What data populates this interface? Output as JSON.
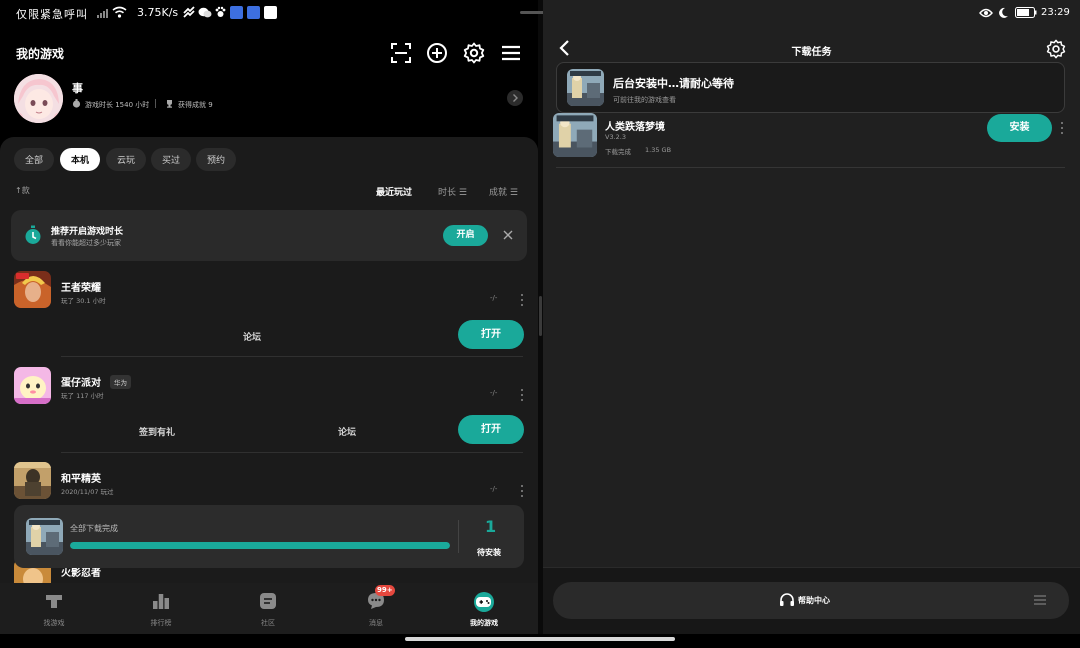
{
  "status_bar": {
    "carrier": "仅限紧急呼叫",
    "net_speed": "3.75K/s",
    "time": "23:29"
  },
  "left": {
    "header_title": "我的游戏",
    "profile": {
      "name": "事",
      "play_time": "游戏时长 1540 小时",
      "achievements": "获得成就 9"
    },
    "filters": [
      "全部",
      "本机",
      "云玩",
      "买过",
      "预约"
    ],
    "active_filter": 1,
    "sort": {
      "count": "↑款",
      "options": [
        "最近玩过",
        "时长 ☰",
        "成就 ☰"
      ]
    },
    "tip": {
      "title": "推荐开启游戏时长",
      "subtitle": "看看你能超过多少玩家",
      "button": "开启"
    },
    "games": [
      {
        "name": "王者荣耀",
        "sub": "玩了 30.1 小时",
        "dash": "-/-",
        "actions": [
          "论坛"
        ],
        "button": "打开"
      },
      {
        "name": "蛋仔派对",
        "tag": "华为",
        "sub": "玩了 117 小时",
        "dash": "-/-",
        "actions": [
          "签到有礼",
          "论坛"
        ],
        "button": "打开"
      },
      {
        "name": "和平精英",
        "sub": "2020/11/07 玩过",
        "dash": "-/-"
      },
      {
        "name": "火影忍者",
        "sub": ""
      }
    ],
    "download_card": {
      "label": "全部下载完成",
      "progress": 1.0,
      "count": "1",
      "pending": "待安装"
    },
    "bottom_nav": [
      {
        "label": "找游戏",
        "icon": "controller-t-icon"
      },
      {
        "label": "排行榜",
        "icon": "ranking-icon"
      },
      {
        "label": "社区",
        "icon": "community-icon"
      },
      {
        "label": "消息",
        "icon": "message-icon",
        "badge": "99+"
      },
      {
        "label": "我的游戏",
        "icon": "my-games-icon"
      }
    ],
    "active_nav": 4
  },
  "right": {
    "title": "下载任务",
    "background_install": {
      "title": "后台安装中…请耐心等待",
      "subtitle": "可前往我的游戏查看"
    },
    "task": {
      "name": "人类跌落梦境",
      "version": "V3.2.3",
      "status": "下载完成",
      "size": "1.35 GB",
      "button": "安装"
    },
    "help": "帮助中心"
  },
  "colors": {
    "accent": "#1aa99a",
    "badge": "#e5483e",
    "panel": "#1b1b1b"
  }
}
